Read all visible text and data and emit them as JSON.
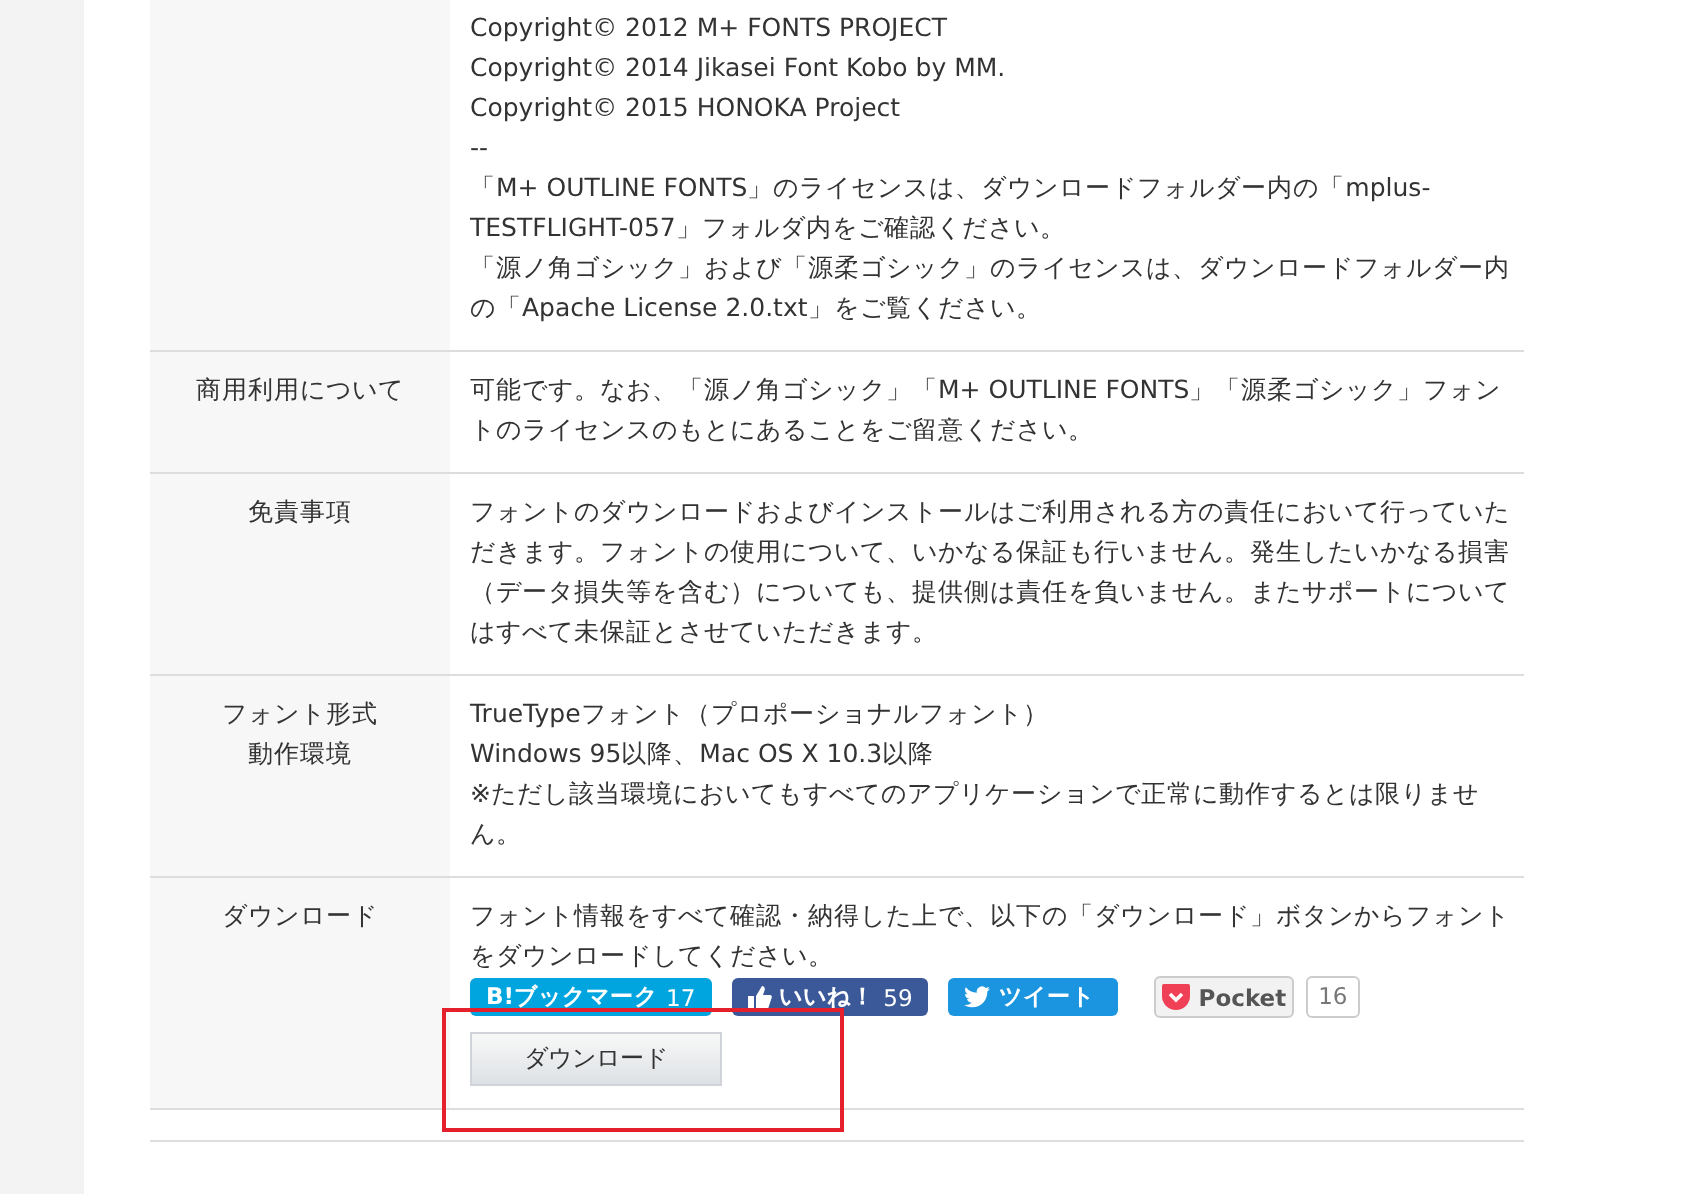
{
  "rows": [
    {
      "content_lines": [
        "Copyright© 2012 M+ FONTS PROJECT",
        "Copyright© 2014 Jikasei Font Kobo by MM.",
        "Copyright© 2015 HONOKA Project",
        "--",
        "「M+ OUTLINE FONTS」のライセンスは、ダウンロードフォルダー内の「mplus-",
        "TESTFLIGHT-057」フォルダ内をご確認ください。",
        "「源ノ角ゴシック」および「源柔ゴシック」のライセンスは、ダウンロードフォルダー内",
        "の「Apache License 2.0.txt」をご覧ください。"
      ]
    },
    {
      "label_lines": [
        "商用利用について"
      ],
      "content_lines": [
        "可能です。なお、「源ノ角ゴシック」「M+ OUTLINE FONTS」「源柔ゴシック」フォン",
        "トのライセンスのもとにあることをご留意ください。"
      ]
    },
    {
      "label_lines": [
        "免責事項"
      ],
      "content_lines": [
        "フォントのダウンロードおよびインストールはご利用される方の責任において行っていた",
        "だきます。フォントの使用について、いかなる保証も行いません。発生したいかなる損害",
        "（データ損失等を含む）についても、提供側は責任を負いません。またサポートについて",
        "はすべて未保証とさせていただきます。"
      ]
    },
    {
      "label_lines": [
        "フォント形式",
        "動作環境"
      ],
      "content_lines": [
        "TrueTypeフォント（プロポーショナルフォント）",
        "Windows 95以降、Mac OS X 10.3以降",
        "※ただし該当環境においてもすべてのアプリケーションで正常に動作するとは限りませ",
        "ん。"
      ]
    },
    {
      "label_lines": [
        "ダウンロード"
      ],
      "content_lines": [
        "フォント情報をすべて確認・納得した上で、以下の「ダウンロード」ボタンからフォント",
        "をダウンロードしてください。"
      ],
      "share_buttons": [
        {
          "kind": "hatena",
          "label": "B!ブックマーク",
          "count": "17"
        },
        {
          "kind": "facebook",
          "label": "いいね！",
          "count": "59"
        },
        {
          "kind": "twitter",
          "label": "ツイート"
        },
        {
          "kind": "pocket",
          "label": "Pocket",
          "count": "16"
        }
      ],
      "download_button": {
        "label": "ダウンロード",
        "highlighted": true
      }
    }
  ]
}
